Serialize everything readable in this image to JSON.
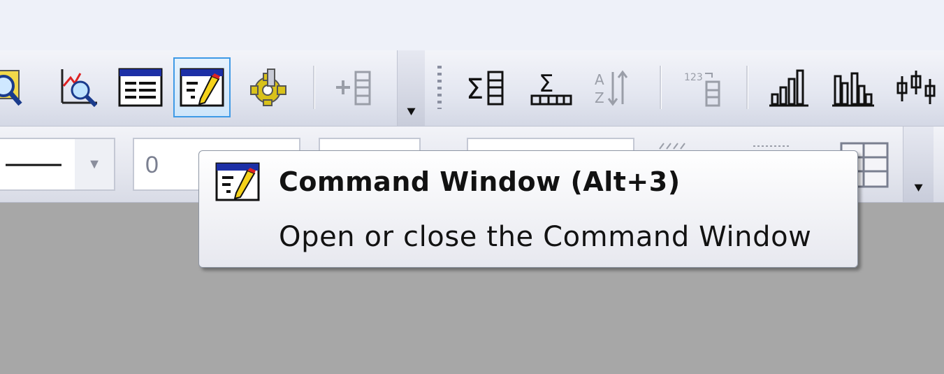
{
  "toolbar": {
    "buttons": [
      {
        "icon": "zoom-graph-icon"
      },
      {
        "icon": "scan-data-icon"
      },
      {
        "icon": "results-log-icon"
      },
      {
        "icon": "command-window-icon",
        "active": true
      },
      {
        "icon": "code-builder-icon"
      },
      {
        "icon": "add-column-icon"
      },
      {
        "icon": "column-statistics-icon"
      },
      {
        "icon": "row-statistics-icon"
      },
      {
        "icon": "sort-icon"
      },
      {
        "icon": "set-column-values-icon"
      },
      {
        "icon": "column-chart-icon"
      },
      {
        "icon": "grouped-column-chart-icon"
      },
      {
        "icon": "hi-lo-chart-icon"
      }
    ],
    "overflow_icon": "toolbar-overflow-icon"
  },
  "format_bar": {
    "line_style_combo": {
      "value": ""
    },
    "number_field": {
      "value": "0"
    }
  },
  "tooltip": {
    "icon": "command-window-icon",
    "title": "Command Window (Alt+3)",
    "description": "Open or close the Command Window"
  },
  "colors": {
    "toolbar_bg": "#e3e6f0",
    "active_button_border": "#3f9ae6",
    "workspace_bg": "#a7a7a7",
    "tooltip_border": "#8e96a4"
  }
}
